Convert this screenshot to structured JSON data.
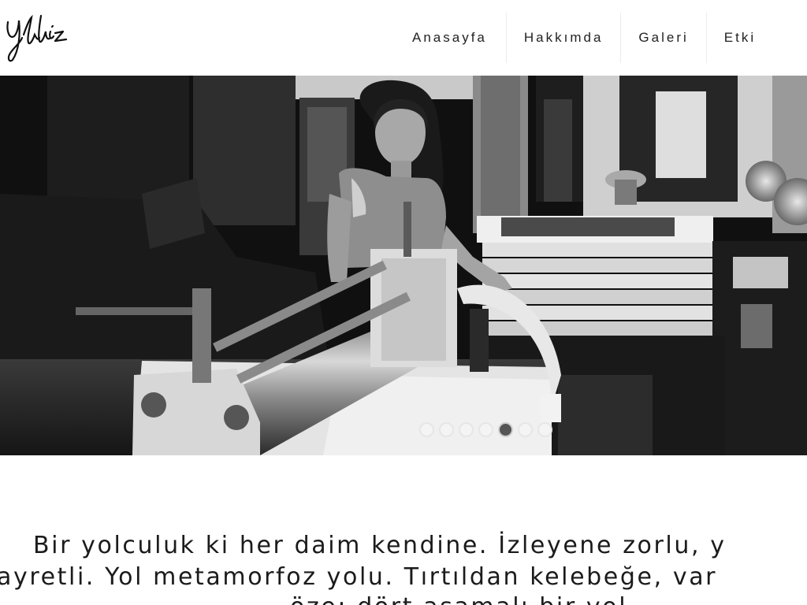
{
  "brand": {
    "logo_text": "Yıldız"
  },
  "nav": {
    "items": [
      {
        "label": "Anasayfa"
      },
      {
        "label": "Hakkımda"
      },
      {
        "label": "Galeri"
      },
      {
        "label": "Etki"
      }
    ]
  },
  "slider": {
    "slide_count": 7,
    "active_index": 5
  },
  "intro": {
    "line1": "Bir yolculuk ki her daim kendine. İzleyene zorlu, y",
    "line2": "ayretli. Yol metamorfoz yolu. Tırtıldan kelebeğe, var",
    "line3": "öze; dört aşamalı bir yol."
  }
}
